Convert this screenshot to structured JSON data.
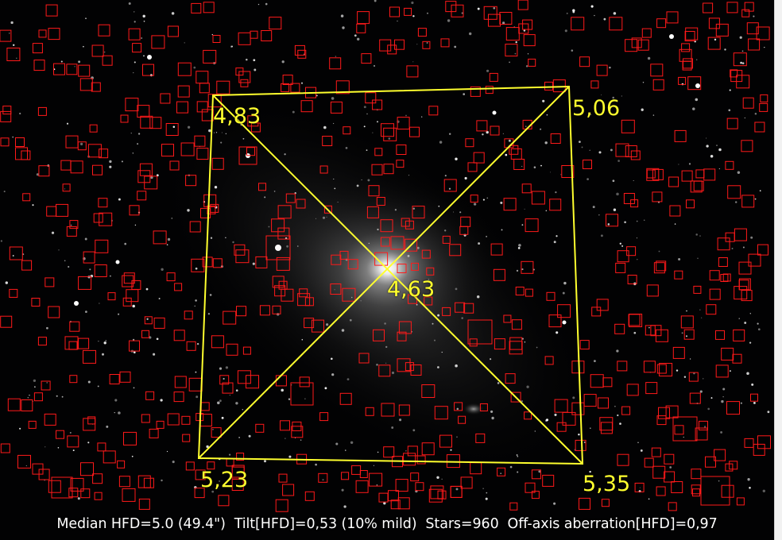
{
  "status": {
    "text": "Median HFD=5.0 (49.4\")  Tilt[HFD]=0,53 (10% mild)  Stars=960  Off-axis aberration[HFD]=0,97"
  },
  "tilt_labels": {
    "top_left": "4,83",
    "top_right": "5,06",
    "center": "4,63",
    "bottom_left": "5,23",
    "bottom_right": "5,35"
  },
  "colors": {
    "tilt_lines": "#ffff2e",
    "star_boxes": "#ff1a1a",
    "star_values": "#e6e62a",
    "status_text": "#ffffff"
  }
}
